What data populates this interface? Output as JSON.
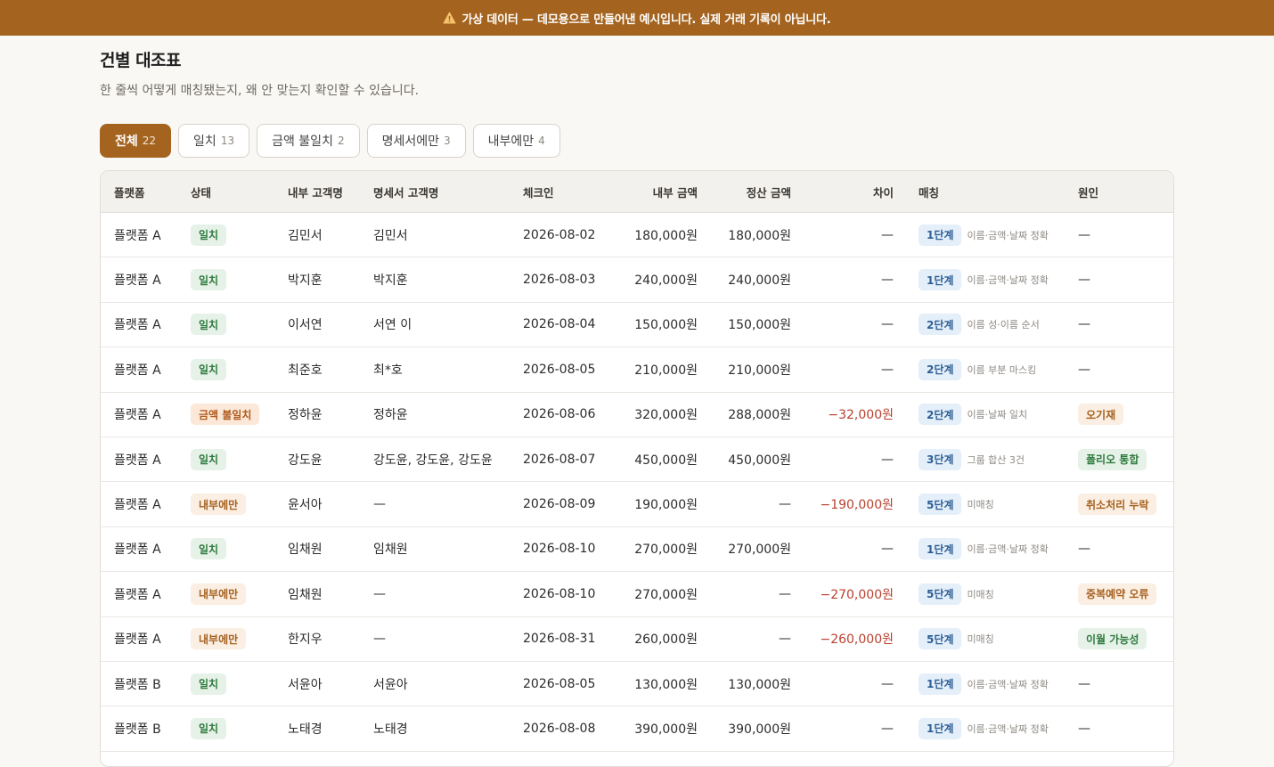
{
  "banner": {
    "icon": "warning-icon",
    "text": "가상 데이터 — 데모용으로 만들어낸 예시입니다. 실제 거래 기록이 아닙니다."
  },
  "page": {
    "title": "건별 대조표",
    "subtitle": "한 줄씩 어떻게 매칭됐는지, 왜 안 맞는지 확인할 수 있습니다."
  },
  "tabs": [
    {
      "label": "전체",
      "count": "22",
      "active": true
    },
    {
      "label": "일치",
      "count": "13",
      "active": false
    },
    {
      "label": "금액 불일치",
      "count": "2",
      "active": false
    },
    {
      "label": "명세서에만",
      "count": "3",
      "active": false
    },
    {
      "label": "내부에만",
      "count": "4",
      "active": false
    }
  ],
  "table": {
    "headers": {
      "platform": "플랫폼",
      "status": "상태",
      "internal_name": "내부 고객명",
      "statement_name": "명세서 고객명",
      "checkin": "체크인",
      "internal_amount": "내부 금액",
      "settled_amount": "정산 금액",
      "diff": "차이",
      "match": "매칭",
      "cause": "원인"
    },
    "rows": [
      {
        "platform": "플랫폼 A",
        "status": "일치",
        "status_kind": "green",
        "internal_name": "김민서",
        "statement_name": "김민서",
        "checkin": "2026-08-02",
        "internal_amount": "180,000원",
        "settled_amount": "180,000원",
        "diff": "—",
        "stage": "1단계",
        "match_desc": "이름·금액·날짜 정확",
        "cause": "—",
        "cause_kind": "none"
      },
      {
        "platform": "플랫폼 A",
        "status": "일치",
        "status_kind": "green",
        "internal_name": "박지훈",
        "statement_name": "박지훈",
        "checkin": "2026-08-03",
        "internal_amount": "240,000원",
        "settled_amount": "240,000원",
        "diff": "—",
        "stage": "1단계",
        "match_desc": "이름·금액·날짜 정확",
        "cause": "—",
        "cause_kind": "none"
      },
      {
        "platform": "플랫폼 A",
        "status": "일치",
        "status_kind": "green",
        "internal_name": "이서연",
        "statement_name": "서연 이",
        "checkin": "2026-08-04",
        "internal_amount": "150,000원",
        "settled_amount": "150,000원",
        "diff": "—",
        "stage": "2단계",
        "match_desc": "이름 성·이름 순서",
        "cause": "—",
        "cause_kind": "none"
      },
      {
        "platform": "플랫폼 A",
        "status": "일치",
        "status_kind": "green",
        "internal_name": "최준호",
        "statement_name": "최*호",
        "checkin": "2026-08-05",
        "internal_amount": "210,000원",
        "settled_amount": "210,000원",
        "diff": "—",
        "stage": "2단계",
        "match_desc": "이름 부분 마스킹",
        "cause": "—",
        "cause_kind": "none"
      },
      {
        "platform": "플랫폼 A",
        "status": "금액 불일치",
        "status_kind": "orange",
        "internal_name": "정하윤",
        "statement_name": "정하윤",
        "checkin": "2026-08-06",
        "internal_amount": "320,000원",
        "settled_amount": "288,000원",
        "diff": "−32,000원",
        "stage": "2단계",
        "match_desc": "이름·날짜 일치",
        "cause": "오기재",
        "cause_kind": "peach"
      },
      {
        "platform": "플랫폼 A",
        "status": "일치",
        "status_kind": "green",
        "internal_name": "강도윤",
        "statement_name": "강도윤, 강도윤, 강도윤",
        "checkin": "2026-08-07",
        "internal_amount": "450,000원",
        "settled_amount": "450,000원",
        "diff": "—",
        "stage": "3단계",
        "match_desc": "그룹 합산 3건",
        "cause": "폴리오 통합",
        "cause_kind": "green"
      },
      {
        "platform": "플랫폼 A",
        "status": "내부에만",
        "status_kind": "peach",
        "internal_name": "윤서아",
        "statement_name": "—",
        "checkin": "2026-08-09",
        "internal_amount": "190,000원",
        "settled_amount": "—",
        "diff": "−190,000원",
        "stage": "5단계",
        "match_desc": "미매칭",
        "cause": "취소처리 누락",
        "cause_kind": "peach"
      },
      {
        "platform": "플랫폼 A",
        "status": "일치",
        "status_kind": "green",
        "internal_name": "임채원",
        "statement_name": "임채원",
        "checkin": "2026-08-10",
        "internal_amount": "270,000원",
        "settled_amount": "270,000원",
        "diff": "—",
        "stage": "1단계",
        "match_desc": "이름·금액·날짜 정확",
        "cause": "—",
        "cause_kind": "none"
      },
      {
        "platform": "플랫폼 A",
        "status": "내부에만",
        "status_kind": "peach",
        "internal_name": "임채원",
        "statement_name": "—",
        "checkin": "2026-08-10",
        "internal_amount": "270,000원",
        "settled_amount": "—",
        "diff": "−270,000원",
        "stage": "5단계",
        "match_desc": "미매칭",
        "cause": "중복예약 오류",
        "cause_kind": "peach"
      },
      {
        "platform": "플랫폼 A",
        "status": "내부에만",
        "status_kind": "peach",
        "internal_name": "한지우",
        "statement_name": "—",
        "checkin": "2026-08-31",
        "internal_amount": "260,000원",
        "settled_amount": "—",
        "diff": "−260,000원",
        "stage": "5단계",
        "match_desc": "미매칭",
        "cause": "이월 가능성",
        "cause_kind": "green"
      },
      {
        "platform": "플랫폼 B",
        "status": "일치",
        "status_kind": "green",
        "internal_name": "서윤아",
        "statement_name": "서윤아",
        "checkin": "2026-08-05",
        "internal_amount": "130,000원",
        "settled_amount": "130,000원",
        "diff": "—",
        "stage": "1단계",
        "match_desc": "이름·금액·날짜 정확",
        "cause": "—",
        "cause_kind": "none"
      },
      {
        "platform": "플랫폼 B",
        "status": "일치",
        "status_kind": "green",
        "internal_name": "노태경",
        "statement_name": "노태경",
        "checkin": "2026-08-08",
        "internal_amount": "390,000원",
        "settled_amount": "390,000원",
        "diff": "—",
        "stage": "1단계",
        "match_desc": "이름·금액·날짜 정확",
        "cause": "—",
        "cause_kind": "none"
      }
    ]
  },
  "colors": {
    "accent": "#a4641f",
    "negative": "#b9402e",
    "match_green": "#2f7a3f",
    "stage_blue": "#2d5f95"
  }
}
